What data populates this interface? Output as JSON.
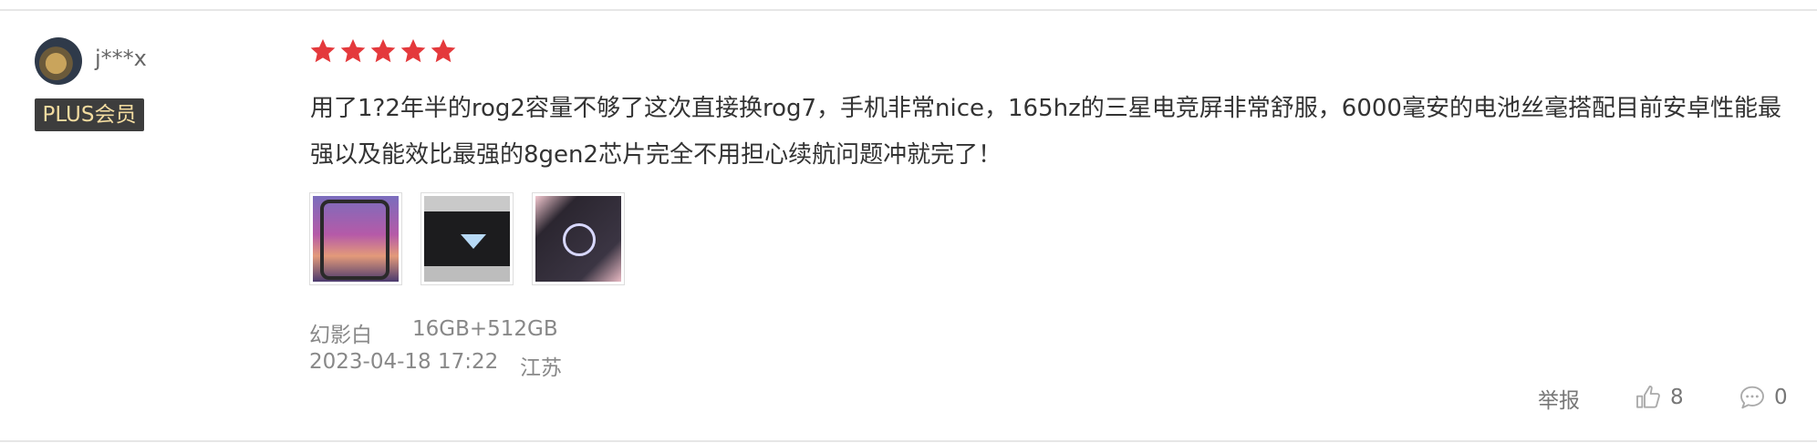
{
  "review": {
    "user": {
      "name": "j***x",
      "badge": "PLUS会员"
    },
    "rating": 5,
    "text": "用了1?2年半的rog2容量不够了这次直接换rog7，手机非常nice，165hz的三星电竞屏非常舒服，6000毫安的电池丝毫搭配目前安卓性能最强以及能效比最强的8gen2芯片完全不用担心续航问题冲就完了！",
    "images": [
      {
        "name": "photo-phone-front"
      },
      {
        "name": "photo-phone-back"
      },
      {
        "name": "photo-phone-lockscreen"
      }
    ],
    "variant": {
      "color": "幻影白",
      "spec": "16GB+512GB"
    },
    "date": "2023-04-18 17:22",
    "region": "江苏",
    "actions": {
      "report_label": "举报",
      "like_count": "8",
      "comment_count": "0"
    }
  },
  "colors": {
    "star": "#e4393c",
    "badge_bg": "#3d3d3d",
    "badge_text": "#f3dca0",
    "meta_text": "#888888"
  },
  "icons": [
    "star-icon",
    "thumbs-up-icon",
    "comment-icon"
  ]
}
